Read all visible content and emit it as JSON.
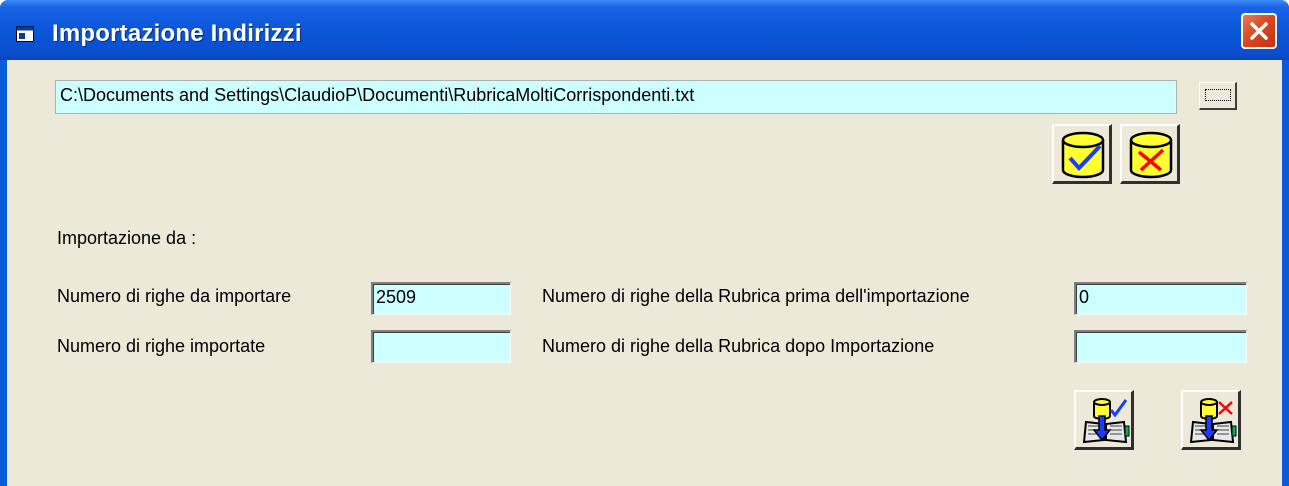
{
  "window": {
    "title": "Importazione Indirizzi",
    "title_icon": "app-window-icon",
    "close_icon": "close-icon"
  },
  "file": {
    "path": "C:\\Documents and Settings\\ClaudioP\\Documenti\\RubricaMoltiCorrispondenti.txt",
    "browse_icon": "ellipsis-browse-icon"
  },
  "actions": {
    "confirm_icon": "database-check-icon",
    "cancel_icon": "database-cross-icon",
    "import_confirm_icon": "import-address-book-check-icon",
    "import_cancel_icon": "import-address-book-cross-icon"
  },
  "form": {
    "source_label": "Importazione da :",
    "rows_to_import_label": "Numero di righe da importare",
    "rows_to_import_value": "2509",
    "rows_imported_label": "Numero di righe importate",
    "rows_imported_value": "",
    "rubrica_before_label": "Numero di righe della Rubrica prima dell'importazione",
    "rubrica_before_value": "0",
    "rubrica_after_label": "Numero di righe della Rubrica  dopo Importazione",
    "rubrica_after_value": ""
  },
  "colors": {
    "titlebar": "#0a56d9",
    "field_background": "#ccffff",
    "dialog_background": "#ece9d8",
    "close_button": "#d9451f",
    "db_yellow": "#ffff33",
    "check_blue": "#1a3cff",
    "cross_red": "#ff0000"
  }
}
